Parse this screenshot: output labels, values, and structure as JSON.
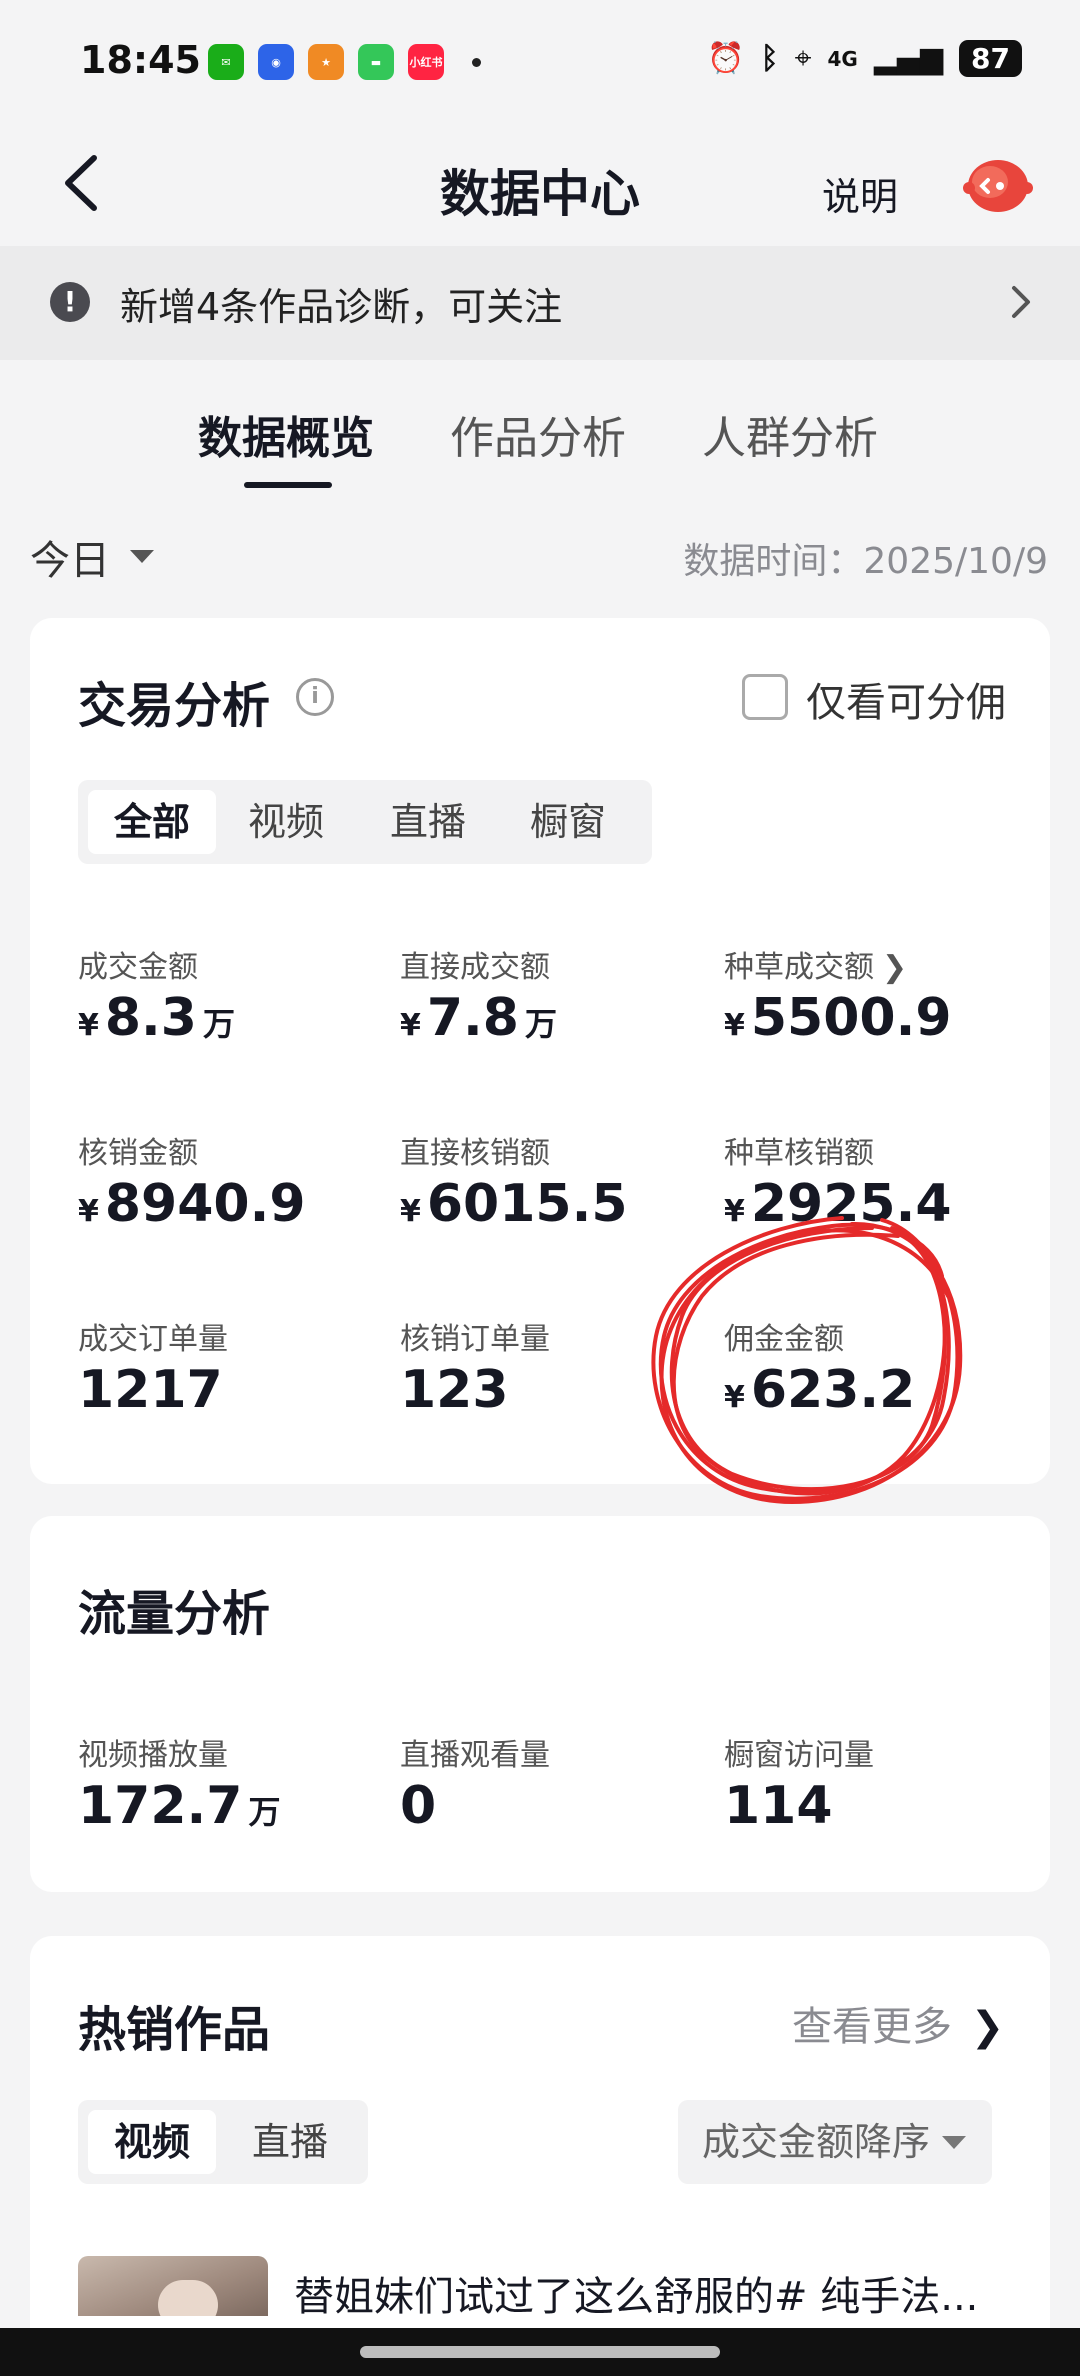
{
  "status_bar": {
    "time": "18:45",
    "network": "4G",
    "battery": "87",
    "apps": [
      {
        "icon": "wechat-icon",
        "color": "#1aad19",
        "label": ""
      },
      {
        "icon": "baidu-icon",
        "color": "#2d64e8",
        "label": ""
      },
      {
        "icon": "game-app-icon",
        "color": "#f08a24",
        "label": ""
      },
      {
        "icon": "messages-icon",
        "color": "#34c759",
        "label": ""
      },
      {
        "icon": "xiaohongshu-icon",
        "color": "#ff2442",
        "label": "小红书"
      }
    ]
  },
  "header": {
    "title": "数据中心",
    "explain": "说明"
  },
  "notice": {
    "text": "新增4条作品诊断，可关注"
  },
  "tabs": [
    {
      "label": "数据概览",
      "active": true
    },
    {
      "label": "作品分析",
      "active": false
    },
    {
      "label": "人群分析",
      "active": false
    }
  ],
  "date_row": {
    "selector": "今日",
    "data_time": "数据时间：2025/10/9"
  },
  "trade": {
    "title": "交易分析",
    "checkbox_label": "仅看可分佣",
    "segments": [
      "全部",
      "视频",
      "直播",
      "橱窗"
    ],
    "metrics": [
      {
        "label": "成交金额",
        "yen": "¥",
        "value": "8.3",
        "unit": "万"
      },
      {
        "label": "直接成交额",
        "yen": "¥",
        "value": "7.8",
        "unit": "万"
      },
      {
        "label": "种草成交额",
        "yen": "¥",
        "value": "5500.9",
        "unit": ""
      },
      {
        "label": "核销金额",
        "yen": "¥",
        "value": "8940.9",
        "unit": ""
      },
      {
        "label": "直接核销额",
        "yen": "¥",
        "value": "6015.5",
        "unit": ""
      },
      {
        "label": "种草核销额",
        "yen": "¥",
        "value": "2925.4",
        "unit": ""
      },
      {
        "label": "成交订单量",
        "yen": "",
        "value": "1217",
        "unit": ""
      },
      {
        "label": "核销订单量",
        "yen": "",
        "value": "123",
        "unit": ""
      },
      {
        "label": "佣金金额",
        "yen": "¥",
        "value": "623.2",
        "unit": ""
      }
    ]
  },
  "traffic": {
    "title": "流量分析",
    "metrics": [
      {
        "label": "视频播放量",
        "value": "172.7",
        "unit": "万"
      },
      {
        "label": "直播观看量",
        "value": "0",
        "unit": ""
      },
      {
        "label": "橱窗访问量",
        "value": "114",
        "unit": ""
      }
    ]
  },
  "hot": {
    "title": "热销作品",
    "more": "查看更多",
    "segments": [
      "视频",
      "直播"
    ],
    "sort": "成交金额降序",
    "first_item_title": "替姐妹们试过了这么舒服的# 纯手法..."
  },
  "annotation_color": "#e52a2a"
}
